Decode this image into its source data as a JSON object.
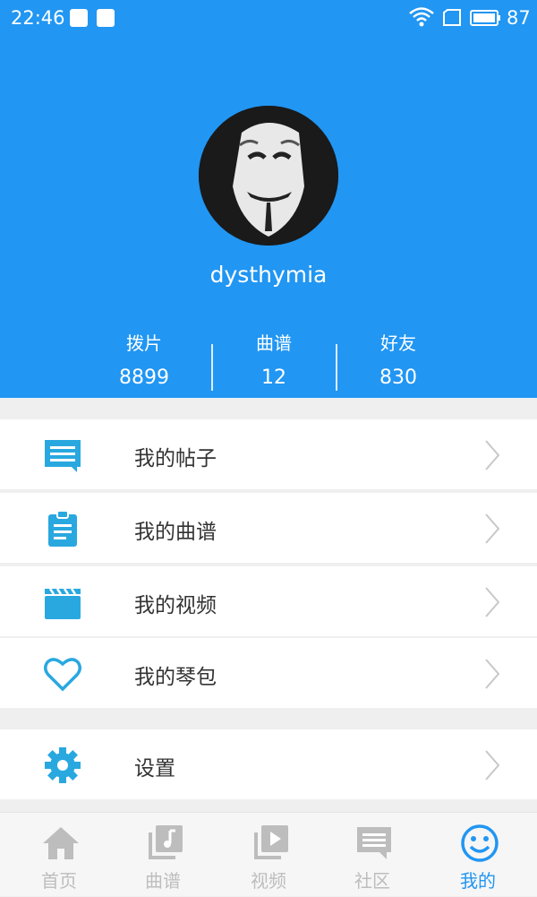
{
  "status_bar": {
    "time": "22:46",
    "battery_pct": "87"
  },
  "profile": {
    "username": "dysthymia",
    "stats": [
      {
        "label": "拨片",
        "value": "8899"
      },
      {
        "label": "曲谱",
        "value": "12"
      },
      {
        "label": "好友",
        "value": "830"
      }
    ]
  },
  "menu": {
    "items": [
      {
        "label": "我的帖子",
        "icon": "comment-icon"
      },
      {
        "label": "我的曲谱",
        "icon": "clipboard-icon"
      },
      {
        "label": "我的视频",
        "icon": "clapperboard-icon"
      },
      {
        "label": "我的琴包",
        "icon": "heart-icon"
      }
    ],
    "settings": {
      "label": "设置",
      "icon": "gear-icon"
    }
  },
  "tabbar": {
    "tabs": [
      {
        "label": "首页",
        "icon": "home-icon"
      },
      {
        "label": "曲谱",
        "icon": "music-library-icon"
      },
      {
        "label": "视频",
        "icon": "video-library-icon"
      },
      {
        "label": "社区",
        "icon": "chat-icon"
      },
      {
        "label": "我的",
        "icon": "smiley-icon"
      }
    ],
    "active_index": 4
  },
  "colors": {
    "primary": "#2196f3",
    "icon_blue": "#29a8e0",
    "tab_inactive": "#bdbdbd"
  }
}
